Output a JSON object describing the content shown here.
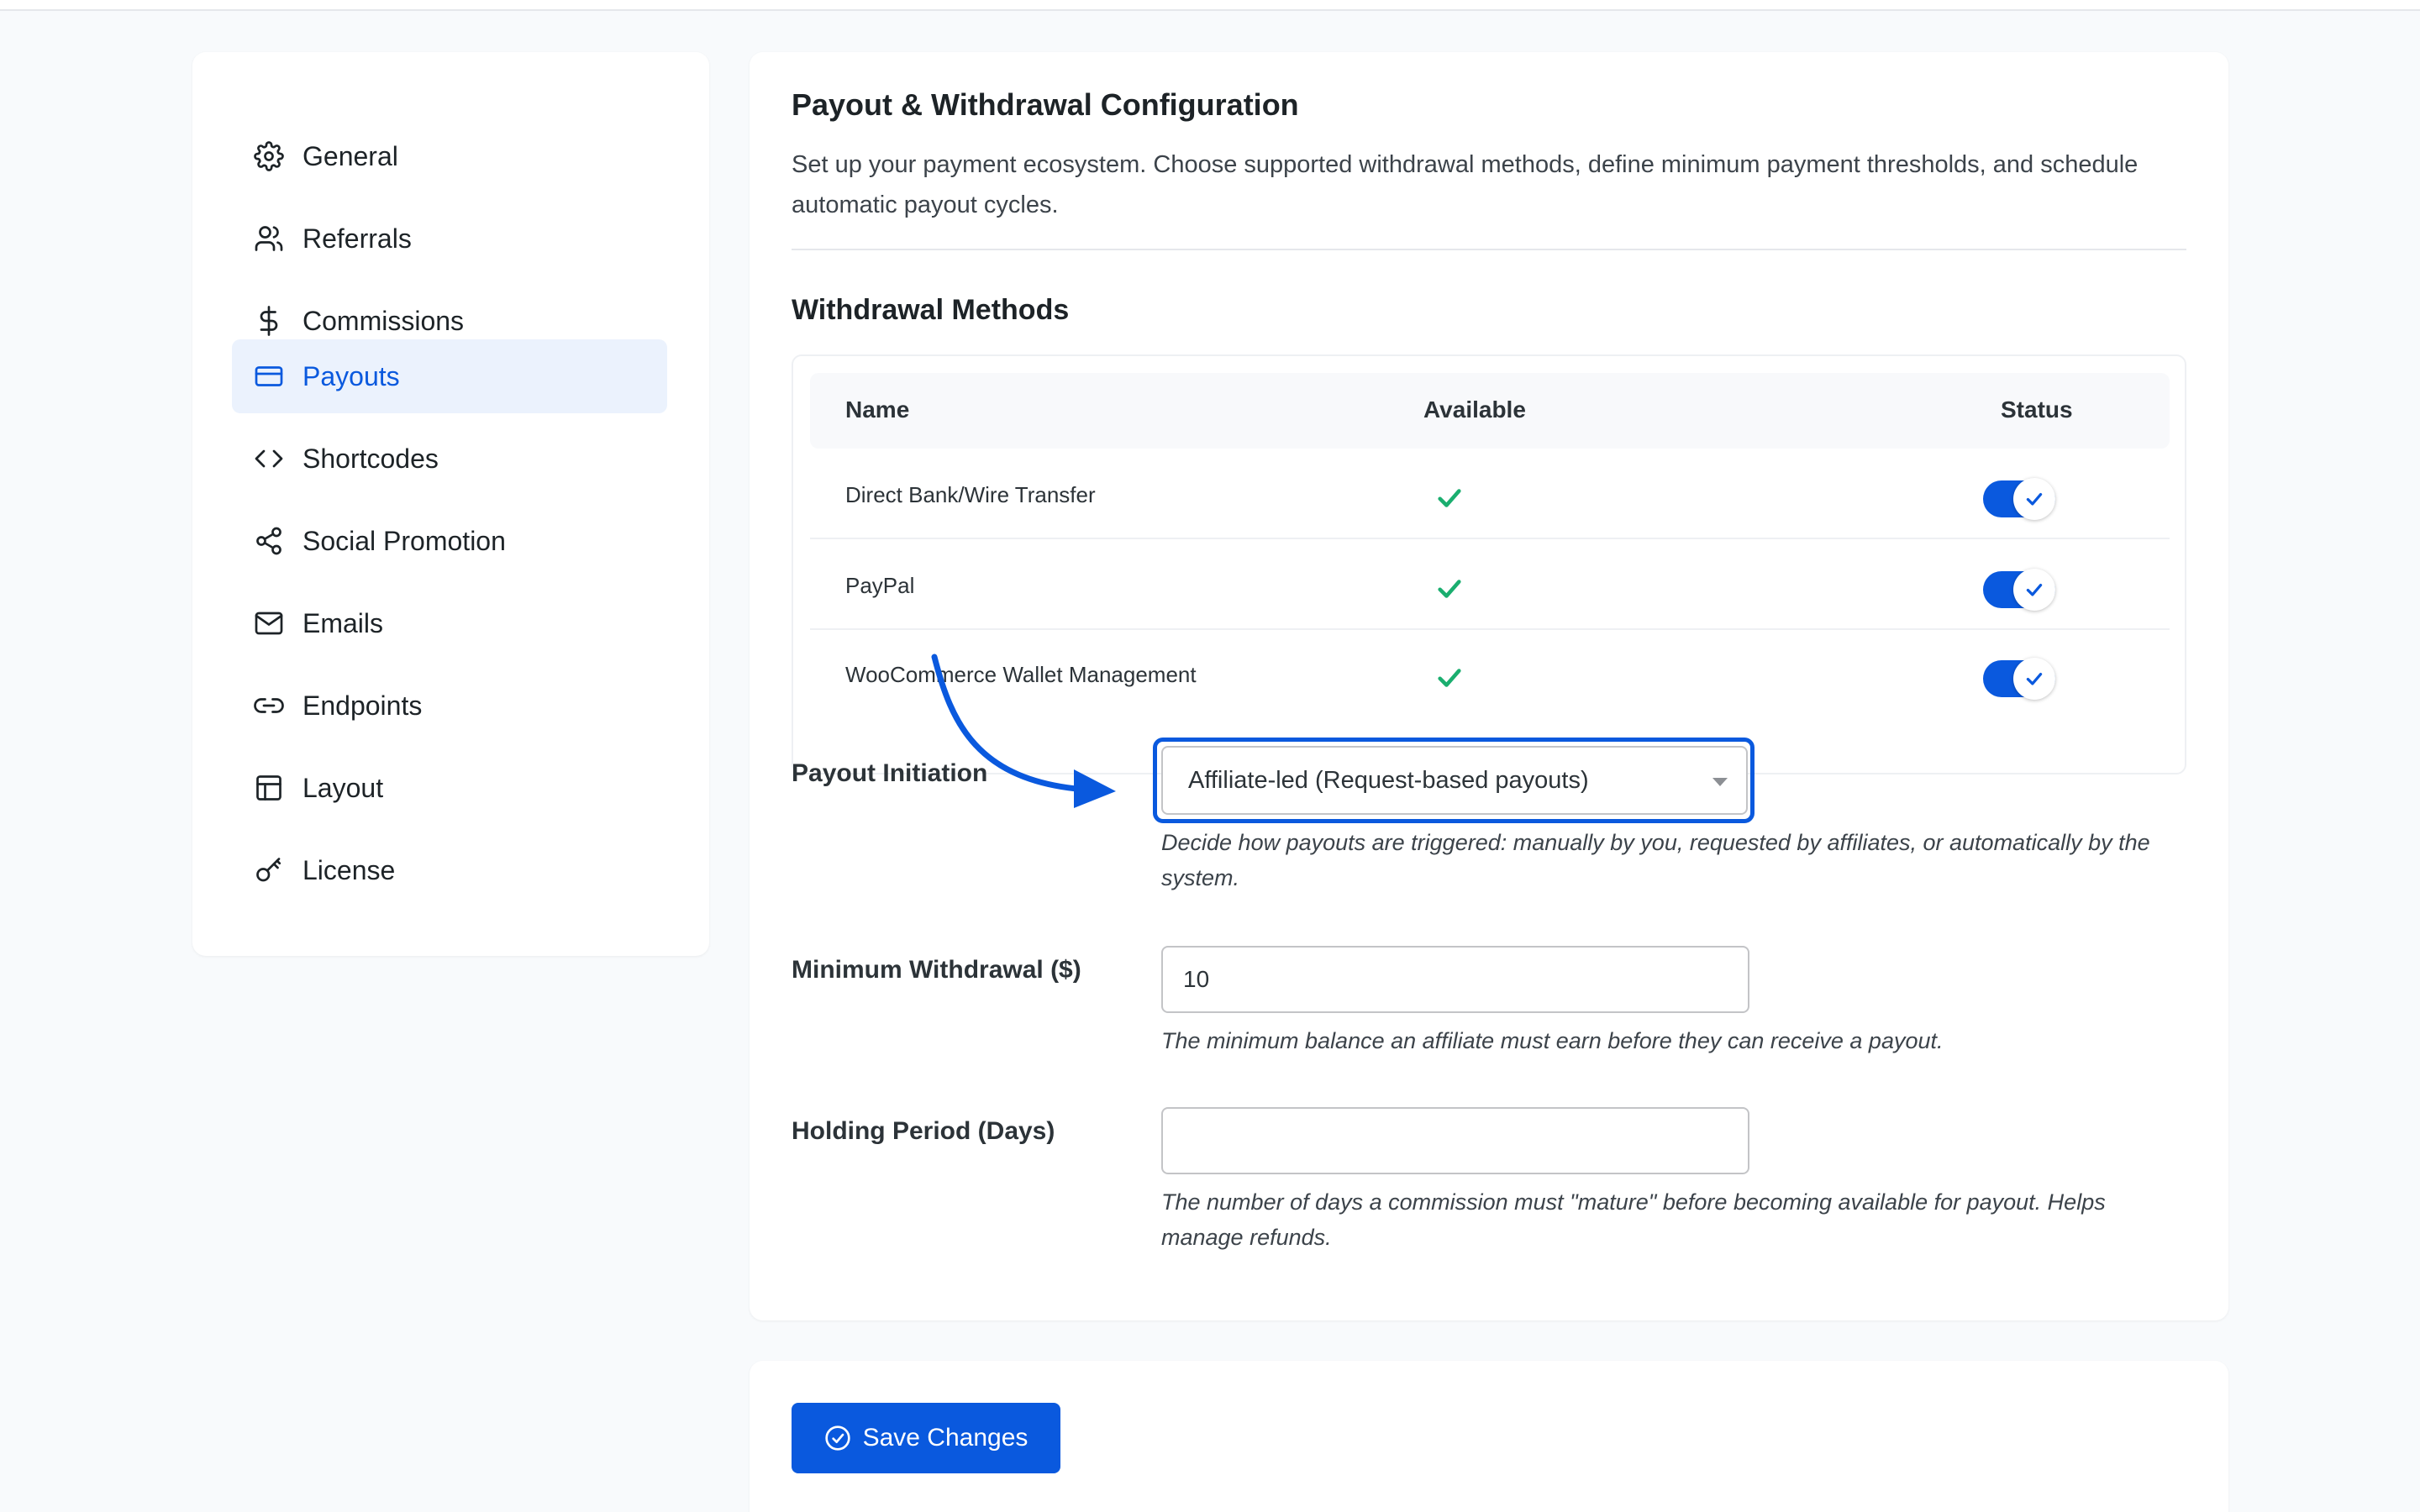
{
  "sidebar": {
    "items": [
      {
        "label": "General",
        "icon": "gear-icon"
      },
      {
        "label": "Referrals",
        "icon": "users-icon"
      },
      {
        "label": "Commissions",
        "icon": "dollar-icon"
      },
      {
        "label": "Payouts",
        "icon": "credit-card-icon",
        "active": true
      },
      {
        "label": "Shortcodes",
        "icon": "code-icon"
      },
      {
        "label": "Social Promotion",
        "icon": "share-icon"
      },
      {
        "label": "Emails",
        "icon": "mail-icon"
      },
      {
        "label": "Endpoints",
        "icon": "link-icon"
      },
      {
        "label": "Layout",
        "icon": "layout-icon"
      },
      {
        "label": "License",
        "icon": "key-icon"
      }
    ]
  },
  "main": {
    "title": "Payout & Withdrawal Configuration",
    "description": "Set up your payment ecosystem. Choose supported withdrawal methods, define minimum payment thresholds, and schedule automatic payout cycles.",
    "methods": {
      "title": "Withdrawal Methods",
      "columns": {
        "name": "Name",
        "available": "Available",
        "status": "Status"
      },
      "rows": [
        {
          "name": "Direct Bank/Wire Transfer",
          "available": true,
          "enabled": true
        },
        {
          "name": "PayPal",
          "available": true,
          "enabled": true
        },
        {
          "name": "WooCommerce Wallet Management",
          "available": true,
          "enabled": true
        }
      ]
    },
    "payout_initiation": {
      "label": "Payout Initiation",
      "value": "Affiliate-led (Request-based payouts)",
      "help": "Decide how payouts are triggered: manually by you, requested by affiliates, or automatically by the system."
    },
    "minimum_withdrawal": {
      "label": "Minimum Withdrawal ($)",
      "value": "10",
      "help": "The minimum balance an affiliate must earn before they can receive a payout."
    },
    "holding_period": {
      "label": "Holding Period (Days)",
      "value": "",
      "help": "The number of days a commission must \"mature\" before becoming available for payout. Helps manage refunds."
    }
  },
  "footer": {
    "save_label": "Save Changes"
  },
  "colors": {
    "accent": "#0a59de",
    "active_bg": "#ebf2fd",
    "success": "#1aae6f"
  }
}
